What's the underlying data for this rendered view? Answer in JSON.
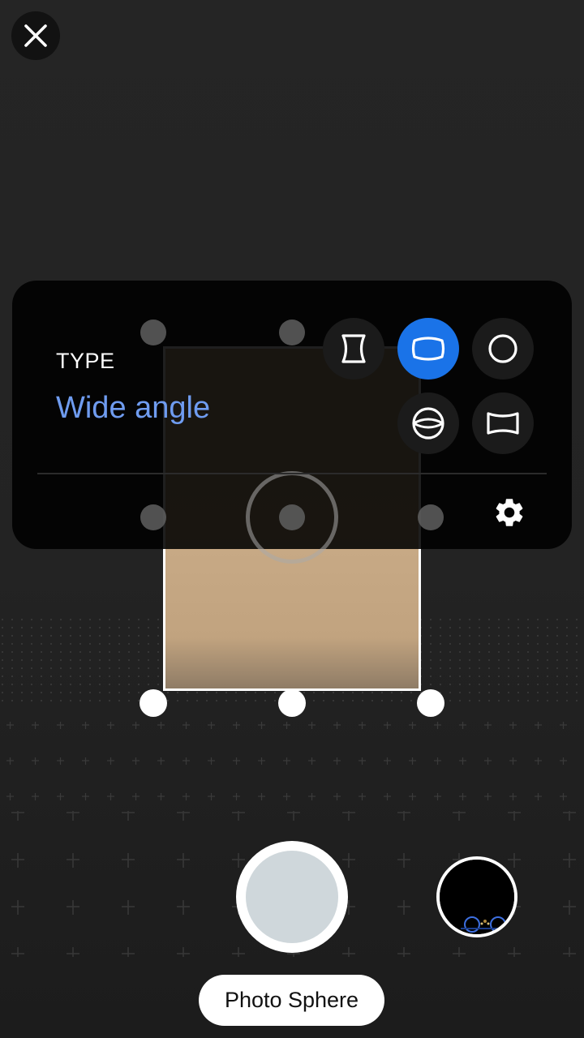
{
  "panel": {
    "type_label": "TYPE",
    "type_value": "Wide angle",
    "options": [
      {
        "name": "hourglass-panorama-icon",
        "selected": false
      },
      {
        "name": "wide-angle-icon",
        "selected": true
      },
      {
        "name": "circle-icon",
        "selected": false
      },
      {
        "name": "sphere-icon",
        "selected": false
      },
      {
        "name": "horizontal-panorama-icon",
        "selected": false
      }
    ]
  },
  "mode": {
    "label": "Photo Sphere"
  },
  "colors": {
    "accent": "#1a73e8",
    "type_value": "#6f9cf0"
  }
}
